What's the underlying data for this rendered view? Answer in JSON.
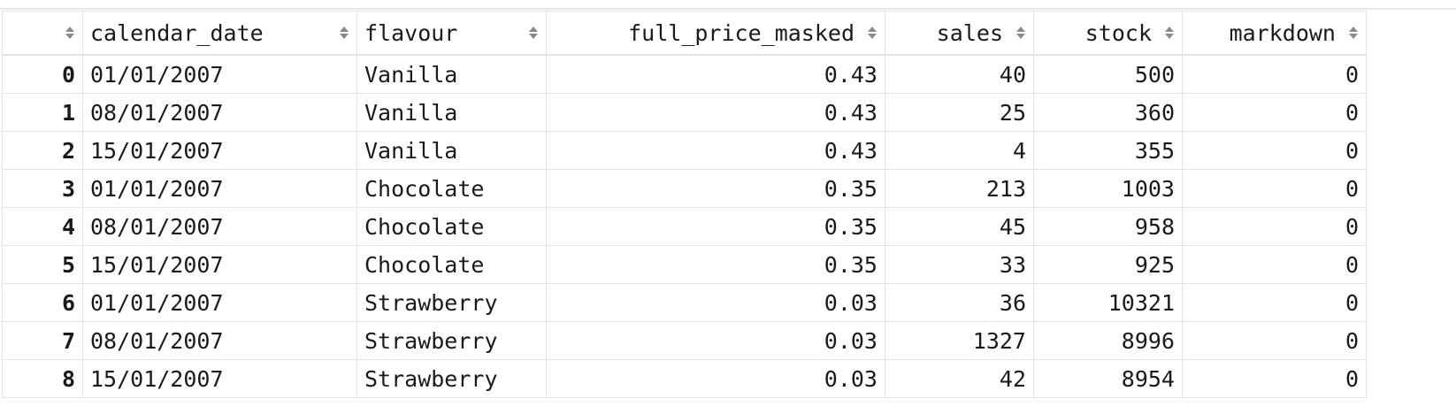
{
  "columns": [
    {
      "key": "index",
      "label": "",
      "align": "right"
    },
    {
      "key": "calendar_date",
      "label": "calendar_date",
      "align": "left"
    },
    {
      "key": "flavour",
      "label": "flavour",
      "align": "left"
    },
    {
      "key": "full_price_masked",
      "label": "full_price_masked",
      "align": "right"
    },
    {
      "key": "sales",
      "label": "sales",
      "align": "right"
    },
    {
      "key": "stock",
      "label": "stock",
      "align": "right"
    },
    {
      "key": "markdown",
      "label": "markdown",
      "align": "right"
    }
  ],
  "rows": [
    [
      "0",
      "01/01/2007",
      "Vanilla",
      "0.43",
      "40",
      "500",
      "0"
    ],
    [
      "1",
      "08/01/2007",
      "Vanilla",
      "0.43",
      "25",
      "360",
      "0"
    ],
    [
      "2",
      "15/01/2007",
      "Vanilla",
      "0.43",
      "4",
      "355",
      "0"
    ],
    [
      "3",
      "01/01/2007",
      "Chocolate",
      "0.35",
      "213",
      "1003",
      "0"
    ],
    [
      "4",
      "08/01/2007",
      "Chocolate",
      "0.35",
      "45",
      "958",
      "0"
    ],
    [
      "5",
      "15/01/2007",
      "Chocolate",
      "0.35",
      "33",
      "925",
      "0"
    ],
    [
      "6",
      "01/01/2007",
      "Strawberry",
      "0.03",
      "36",
      "10321",
      "0"
    ],
    [
      "7",
      "08/01/2007",
      "Strawberry",
      "0.03",
      "1327",
      "8996",
      "0"
    ],
    [
      "8",
      "15/01/2007",
      "Strawberry",
      "0.03",
      "42",
      "8954",
      "0"
    ]
  ],
  "sort_icon": "sort-updown-icon",
  "colors": {
    "border": "#e3e3e3",
    "text": "#1a1a1a",
    "sort_icon": "#8a8a8a"
  }
}
